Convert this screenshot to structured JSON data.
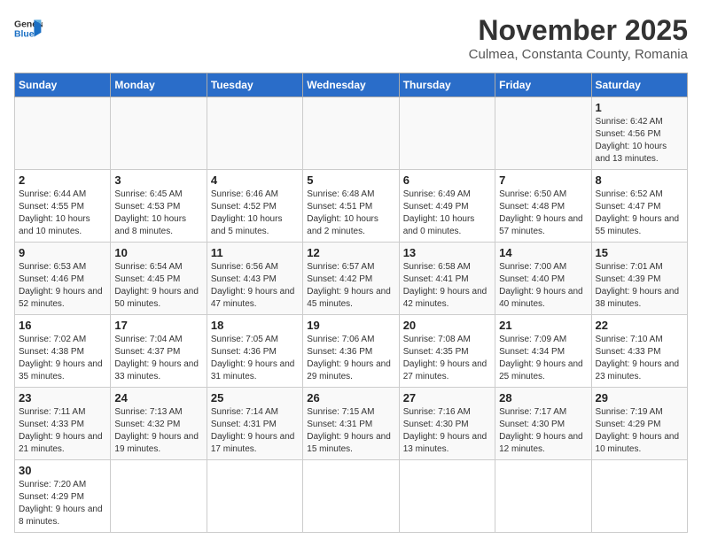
{
  "header": {
    "logo_general": "General",
    "logo_blue": "Blue",
    "title": "November 2025",
    "subtitle": "Culmea, Constanta County, Romania"
  },
  "days_of_week": [
    "Sunday",
    "Monday",
    "Tuesday",
    "Wednesday",
    "Thursday",
    "Friday",
    "Saturday"
  ],
  "weeks": [
    [
      {
        "day": "",
        "info": ""
      },
      {
        "day": "",
        "info": ""
      },
      {
        "day": "",
        "info": ""
      },
      {
        "day": "",
        "info": ""
      },
      {
        "day": "",
        "info": ""
      },
      {
        "day": "",
        "info": ""
      },
      {
        "day": "1",
        "info": "Sunrise: 6:42 AM\nSunset: 4:56 PM\nDaylight: 10 hours\nand 13 minutes."
      }
    ],
    [
      {
        "day": "2",
        "info": "Sunrise: 6:44 AM\nSunset: 4:55 PM\nDaylight: 10 hours\nand 10 minutes."
      },
      {
        "day": "3",
        "info": "Sunrise: 6:45 AM\nSunset: 4:53 PM\nDaylight: 10 hours\nand 8 minutes."
      },
      {
        "day": "4",
        "info": "Sunrise: 6:46 AM\nSunset: 4:52 PM\nDaylight: 10 hours\nand 5 minutes."
      },
      {
        "day": "5",
        "info": "Sunrise: 6:48 AM\nSunset: 4:51 PM\nDaylight: 10 hours\nand 2 minutes."
      },
      {
        "day": "6",
        "info": "Sunrise: 6:49 AM\nSunset: 4:49 PM\nDaylight: 10 hours\nand 0 minutes."
      },
      {
        "day": "7",
        "info": "Sunrise: 6:50 AM\nSunset: 4:48 PM\nDaylight: 9 hours\nand 57 minutes."
      },
      {
        "day": "8",
        "info": "Sunrise: 6:52 AM\nSunset: 4:47 PM\nDaylight: 9 hours\nand 55 minutes."
      }
    ],
    [
      {
        "day": "9",
        "info": "Sunrise: 6:53 AM\nSunset: 4:46 PM\nDaylight: 9 hours\nand 52 minutes."
      },
      {
        "day": "10",
        "info": "Sunrise: 6:54 AM\nSunset: 4:45 PM\nDaylight: 9 hours\nand 50 minutes."
      },
      {
        "day": "11",
        "info": "Sunrise: 6:56 AM\nSunset: 4:43 PM\nDaylight: 9 hours\nand 47 minutes."
      },
      {
        "day": "12",
        "info": "Sunrise: 6:57 AM\nSunset: 4:42 PM\nDaylight: 9 hours\nand 45 minutes."
      },
      {
        "day": "13",
        "info": "Sunrise: 6:58 AM\nSunset: 4:41 PM\nDaylight: 9 hours\nand 42 minutes."
      },
      {
        "day": "14",
        "info": "Sunrise: 7:00 AM\nSunset: 4:40 PM\nDaylight: 9 hours\nand 40 minutes."
      },
      {
        "day": "15",
        "info": "Sunrise: 7:01 AM\nSunset: 4:39 PM\nDaylight: 9 hours\nand 38 minutes."
      }
    ],
    [
      {
        "day": "16",
        "info": "Sunrise: 7:02 AM\nSunset: 4:38 PM\nDaylight: 9 hours\nand 35 minutes."
      },
      {
        "day": "17",
        "info": "Sunrise: 7:04 AM\nSunset: 4:37 PM\nDaylight: 9 hours\nand 33 minutes."
      },
      {
        "day": "18",
        "info": "Sunrise: 7:05 AM\nSunset: 4:36 PM\nDaylight: 9 hours\nand 31 minutes."
      },
      {
        "day": "19",
        "info": "Sunrise: 7:06 AM\nSunset: 4:36 PM\nDaylight: 9 hours\nand 29 minutes."
      },
      {
        "day": "20",
        "info": "Sunrise: 7:08 AM\nSunset: 4:35 PM\nDaylight: 9 hours\nand 27 minutes."
      },
      {
        "day": "21",
        "info": "Sunrise: 7:09 AM\nSunset: 4:34 PM\nDaylight: 9 hours\nand 25 minutes."
      },
      {
        "day": "22",
        "info": "Sunrise: 7:10 AM\nSunset: 4:33 PM\nDaylight: 9 hours\nand 23 minutes."
      }
    ],
    [
      {
        "day": "23",
        "info": "Sunrise: 7:11 AM\nSunset: 4:33 PM\nDaylight: 9 hours\nand 21 minutes."
      },
      {
        "day": "24",
        "info": "Sunrise: 7:13 AM\nSunset: 4:32 PM\nDaylight: 9 hours\nand 19 minutes."
      },
      {
        "day": "25",
        "info": "Sunrise: 7:14 AM\nSunset: 4:31 PM\nDaylight: 9 hours\nand 17 minutes."
      },
      {
        "day": "26",
        "info": "Sunrise: 7:15 AM\nSunset: 4:31 PM\nDaylight: 9 hours\nand 15 minutes."
      },
      {
        "day": "27",
        "info": "Sunrise: 7:16 AM\nSunset: 4:30 PM\nDaylight: 9 hours\nand 13 minutes."
      },
      {
        "day": "28",
        "info": "Sunrise: 7:17 AM\nSunset: 4:30 PM\nDaylight: 9 hours\nand 12 minutes."
      },
      {
        "day": "29",
        "info": "Sunrise: 7:19 AM\nSunset: 4:29 PM\nDaylight: 9 hours\nand 10 minutes."
      }
    ],
    [
      {
        "day": "30",
        "info": "Sunrise: 7:20 AM\nSunset: 4:29 PM\nDaylight: 9 hours\nand 8 minutes."
      },
      {
        "day": "",
        "info": ""
      },
      {
        "day": "",
        "info": ""
      },
      {
        "day": "",
        "info": ""
      },
      {
        "day": "",
        "info": ""
      },
      {
        "day": "",
        "info": ""
      },
      {
        "day": "",
        "info": ""
      }
    ]
  ]
}
